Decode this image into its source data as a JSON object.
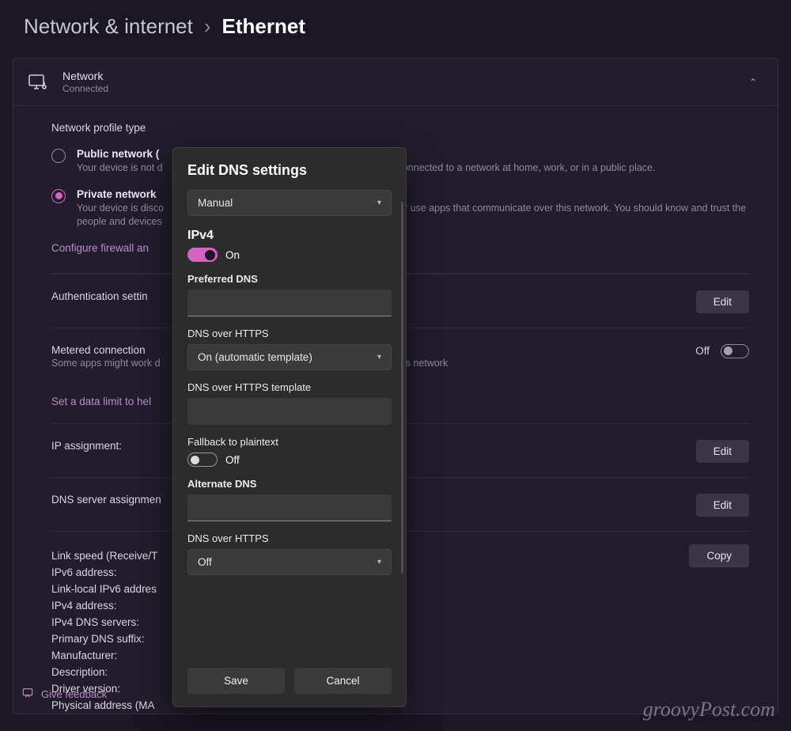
{
  "breadcrumb": {
    "parent": "Network & internet",
    "sep": "›",
    "current": "Ethernet"
  },
  "header": {
    "name": "Network",
    "status": "Connected"
  },
  "profile": {
    "title": "Network profile type",
    "public": {
      "label": "Public network (",
      "desc": "Your device is not d"
    },
    "private": {
      "label": "Private network",
      "desc_pre": "Your device is disco",
      "desc_post": "or use apps that communicate over this network. You should know and trust the people and devices"
    },
    "bg_public_desc_tail": "connected to a network at home, work, or in a public place.",
    "firewall_link": "Configure firewall an"
  },
  "rows": {
    "auth": {
      "label": "Authentication settin",
      "btn": "Edit"
    },
    "metered": {
      "label": "Metered connection",
      "sub_pre": "Some apps might work d",
      "sub_post": "this network",
      "state": "Off"
    },
    "datalimit": "Set a data limit to hel",
    "ip": {
      "label": "IP assignment:",
      "btn": "Edit"
    },
    "dns": {
      "label": "DNS server assignmen",
      "btn": "Edit"
    }
  },
  "details": {
    "lines": [
      "Link speed (Receive/T",
      "IPv6 address:",
      "Link-local IPv6 addres",
      "IPv4 address:",
      "IPv4 DNS servers:",
      "Primary DNS suffix:",
      "Manufacturer:",
      "Description:",
      "Driver version:",
      "Physical address (MA"
    ],
    "copy": "Copy"
  },
  "feedback": "Give feedback",
  "watermark": "groovyPost.com",
  "dialog": {
    "title": "Edit DNS settings",
    "mode": "Manual",
    "ipv4": "IPv4",
    "ipv4_on": "On",
    "preferred": "Preferred DNS",
    "doh": "DNS over HTTPS",
    "doh_val": "On (automatic template)",
    "doh_tmpl": "DNS over HTTPS template",
    "fallback": "Fallback to plaintext",
    "fallback_state": "Off",
    "alt": "Alternate DNS",
    "doh2": "DNS over HTTPS",
    "doh2_val": "Off",
    "save": "Save",
    "cancel": "Cancel"
  }
}
